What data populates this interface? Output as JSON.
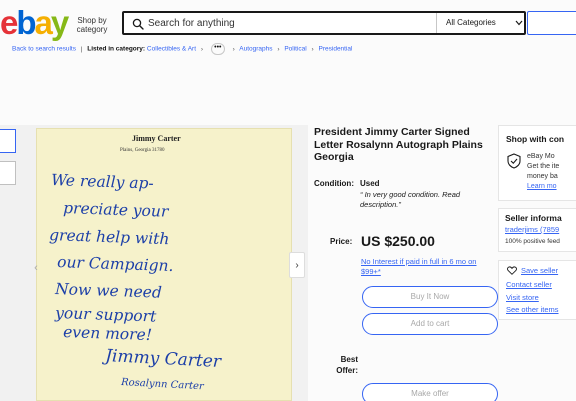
{
  "header": {
    "logo_letters": [
      "e",
      "b",
      "a",
      "y"
    ],
    "logo_colors": [
      "#e53238",
      "#0064d2",
      "#f5af02",
      "#86b817"
    ],
    "shop_by_category": "Shop by category",
    "search_placeholder": "Search for anything",
    "category_select": "All Categories"
  },
  "breadcrumb": {
    "back": "Back to search results",
    "listed_in": "Listed in category:",
    "items": [
      "Collectibles & Art",
      "Autographs",
      "Political",
      "Presidential"
    ],
    "more": "•••"
  },
  "letter": {
    "letterhead_name": "Jimmy Carter",
    "letterhead_place": "Plains, Georgia 31780",
    "lines": [
      "We really ap-",
      "preciate your",
      "great help with",
      "our Campaign.",
      "Now we need",
      "your support",
      "even more!"
    ],
    "signature": "Jimmy Carter",
    "signature2": "Rosalynn Carter"
  },
  "item": {
    "title": "President Jimmy Carter Signed Letter Rosalynn Autograph Plains Georgia",
    "condition_label": "Condition:",
    "condition_value": "Used",
    "condition_desc": "“ In very good condition. Read description.”",
    "price_label": "Price:",
    "price": "US $250.00",
    "financing": "No Interest if paid in full in 6 mo on $99+*",
    "buy_now": "Buy It Now",
    "add_to_cart": "Add to cart",
    "best_offer_label": "Best Offer:",
    "make_offer": "Make offer"
  },
  "sidebar": {
    "shop_heading": "Shop with con",
    "promo_title": "eBay Mo",
    "promo_text": "Get the ite money ba",
    "learn_more": "Learn mo",
    "seller_heading": "Seller informa",
    "seller_name": "traderjims (7859",
    "feedback": "100% positive feed",
    "save_seller": "Save seller",
    "contact_seller": "Contact seller",
    "visit_store": "Visit store",
    "other_items": "See other items"
  }
}
